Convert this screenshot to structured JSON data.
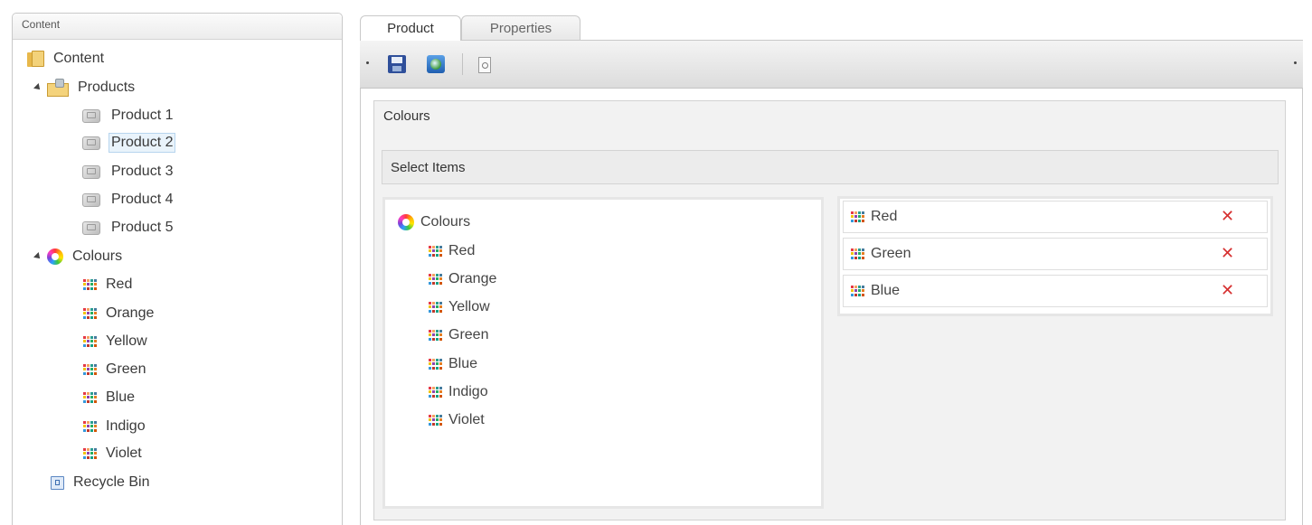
{
  "left_panel": {
    "header": "Content",
    "root": {
      "label": "Content",
      "icon": "folder-icon"
    },
    "products": {
      "label": "Products",
      "icon": "product-folder-icon",
      "children": [
        "Product 1",
        "Product 2",
        "Product 3",
        "Product 4",
        "Product 5"
      ],
      "selected": "Product 2"
    },
    "colours": {
      "label": "Colours",
      "icon": "colour-wheel-icon",
      "children": [
        "Red",
        "Orange",
        "Yellow",
        "Green",
        "Blue",
        "Indigo",
        "Violet"
      ]
    },
    "recycle_bin": {
      "label": "Recycle Bin",
      "icon": "recycle-bin-icon"
    }
  },
  "tabs": [
    {
      "label": "Product",
      "active": true
    },
    {
      "label": "Properties",
      "active": false
    }
  ],
  "toolbar": {
    "buttons": [
      "save-icon",
      "save-and-publish-icon",
      "preview-icon"
    ]
  },
  "property": {
    "title": "Colours",
    "picker_title": "Select Items",
    "source_root": "Colours",
    "source_items": [
      "Red",
      "Orange",
      "Yellow",
      "Green",
      "Blue",
      "Indigo",
      "Violet"
    ],
    "selected_items": [
      "Red",
      "Green",
      "Blue"
    ],
    "remove_symbol": "✕"
  },
  "colors": {
    "remove": "#d63030",
    "selected_bg": "#e9f3fb",
    "folder": "#f3d27a"
  }
}
